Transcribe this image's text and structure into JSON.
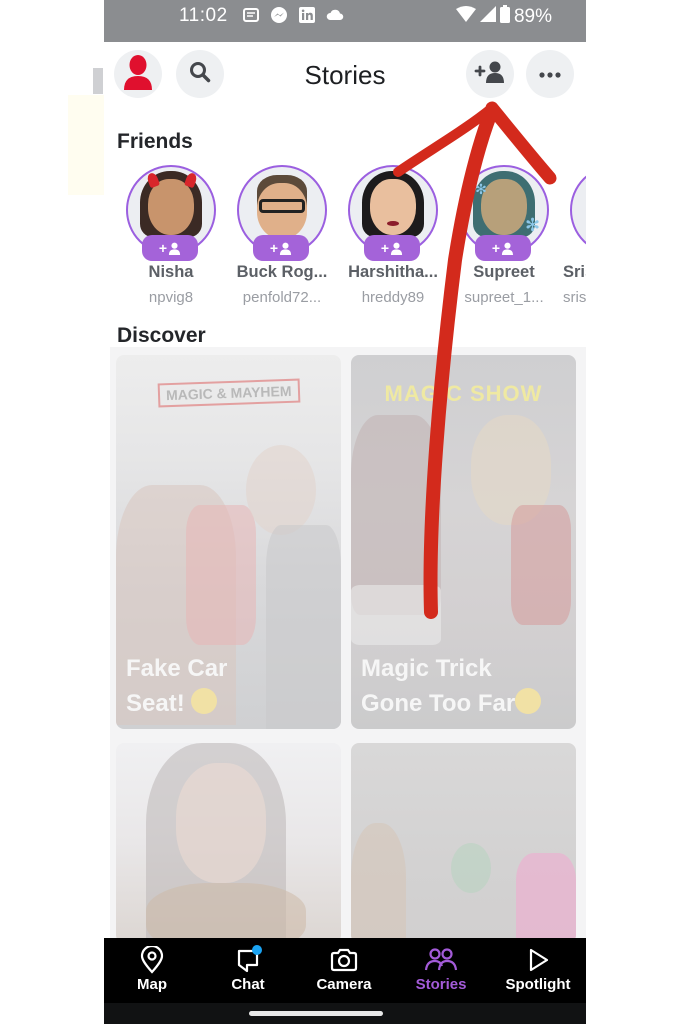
{
  "status_bar": {
    "time": "11:02",
    "notification_icons": [
      "news-icon",
      "messenger-icon",
      "linkedin-icon",
      "cloud-icon"
    ],
    "wifi": "wifi-icon",
    "signal": "signal-icon",
    "battery_percent": "89%"
  },
  "header": {
    "title": "Stories",
    "profile_icon": "profile-icon",
    "search_icon": "search-icon",
    "add_friend_icon": "add-friend-icon",
    "more_icon": "more-icon"
  },
  "friends": {
    "title": "Friends",
    "badge_label": "+",
    "items": [
      {
        "name": "Nisha",
        "username": "npvig8"
      },
      {
        "name": "Buck Rog...",
        "username": "penfold72..."
      },
      {
        "name": "Harshitha...",
        "username": "hreddy89"
      },
      {
        "name": "Supreet",
        "username": "supreet_1..."
      },
      {
        "name": "Sris",
        "username": "sris"
      }
    ]
  },
  "discover": {
    "title": "Discover",
    "cards": [
      {
        "brand": "MAGIC & MAYHEM",
        "title_line1": "Fake Car",
        "title_line2": "Seat!",
        "emoji": "rolling-laughing-emoji"
      },
      {
        "brand": "MAGIC SHOW",
        "title_line1": "Magic Trick",
        "title_line2": "Gone Too Far",
        "emoji": "expressionless-emoji"
      },
      {
        "brand": "",
        "title_line1": "",
        "title_line2": ""
      },
      {
        "brand": "",
        "title_line1": "",
        "title_line2": ""
      }
    ]
  },
  "nav": {
    "items": [
      {
        "label": "Map",
        "icon": "map-pin-icon"
      },
      {
        "label": "Chat",
        "icon": "chat-icon",
        "has_dot": true
      },
      {
        "label": "Camera",
        "icon": "camera-icon"
      },
      {
        "label": "Stories",
        "icon": "stories-icon",
        "active": true
      },
      {
        "label": "Spotlight",
        "icon": "spotlight-icon"
      }
    ]
  },
  "colors": {
    "accent_purple": "#a463d9",
    "status_bar_gray": "#8b8d90",
    "profile_red": "#e0102e",
    "chat_dot_blue": "#1aa3f2",
    "annotation_red": "#d32a1c"
  }
}
